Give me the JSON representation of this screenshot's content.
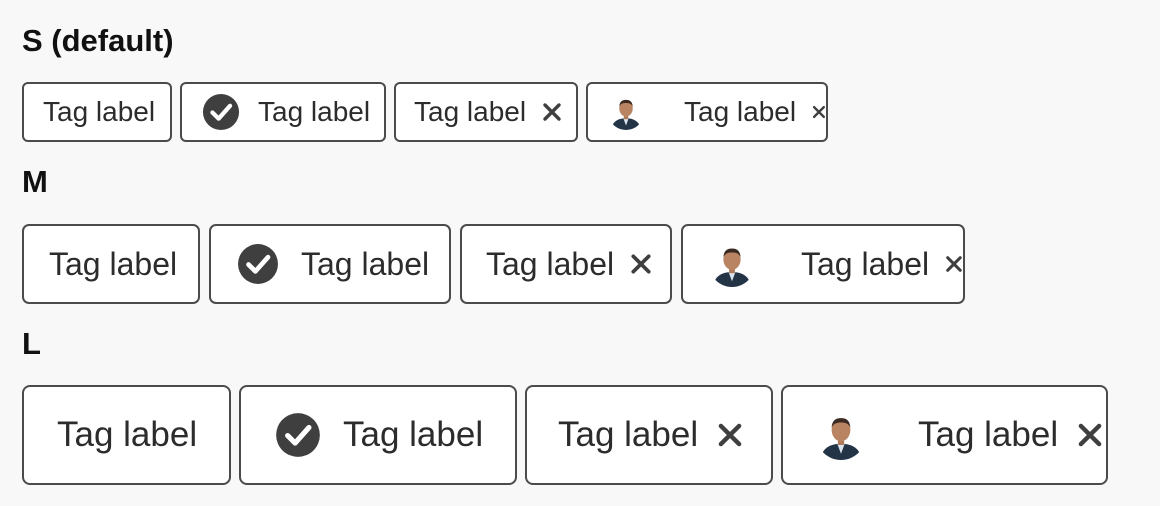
{
  "colors": {
    "background": "#f8f8f8",
    "tag_border": "#4b4b4b",
    "tag_fill": "#ffffff",
    "text": "#2c2c2c",
    "icon": "#3f3f3f"
  },
  "sections": [
    {
      "heading": "S (default)",
      "tags": [
        {
          "variant": "plain",
          "label": "Tag label"
        },
        {
          "variant": "icon",
          "icon": "checkmark-circle-icon",
          "label": "Tag label"
        },
        {
          "variant": "removable",
          "label": "Tag label",
          "remove_icon": "close-icon"
        },
        {
          "variant": "avatar-removable",
          "avatar": "avatar",
          "label": "Tag label",
          "remove_icon": "close-icon"
        }
      ]
    },
    {
      "heading": "M",
      "tags": [
        {
          "variant": "plain",
          "label": "Tag label"
        },
        {
          "variant": "icon",
          "icon": "checkmark-circle-icon",
          "label": "Tag label"
        },
        {
          "variant": "removable",
          "label": "Tag label",
          "remove_icon": "close-icon"
        },
        {
          "variant": "avatar-removable",
          "avatar": "avatar",
          "label": "Tag label",
          "remove_icon": "close-icon"
        }
      ]
    },
    {
      "heading": "L",
      "tags": [
        {
          "variant": "plain",
          "label": "Tag label"
        },
        {
          "variant": "icon",
          "icon": "checkmark-circle-icon",
          "label": "Tag label"
        },
        {
          "variant": "removable",
          "label": "Tag label",
          "remove_icon": "close-icon"
        },
        {
          "variant": "avatar-removable",
          "avatar": "avatar",
          "label": "Tag label",
          "remove_icon": "close-icon"
        }
      ]
    }
  ]
}
